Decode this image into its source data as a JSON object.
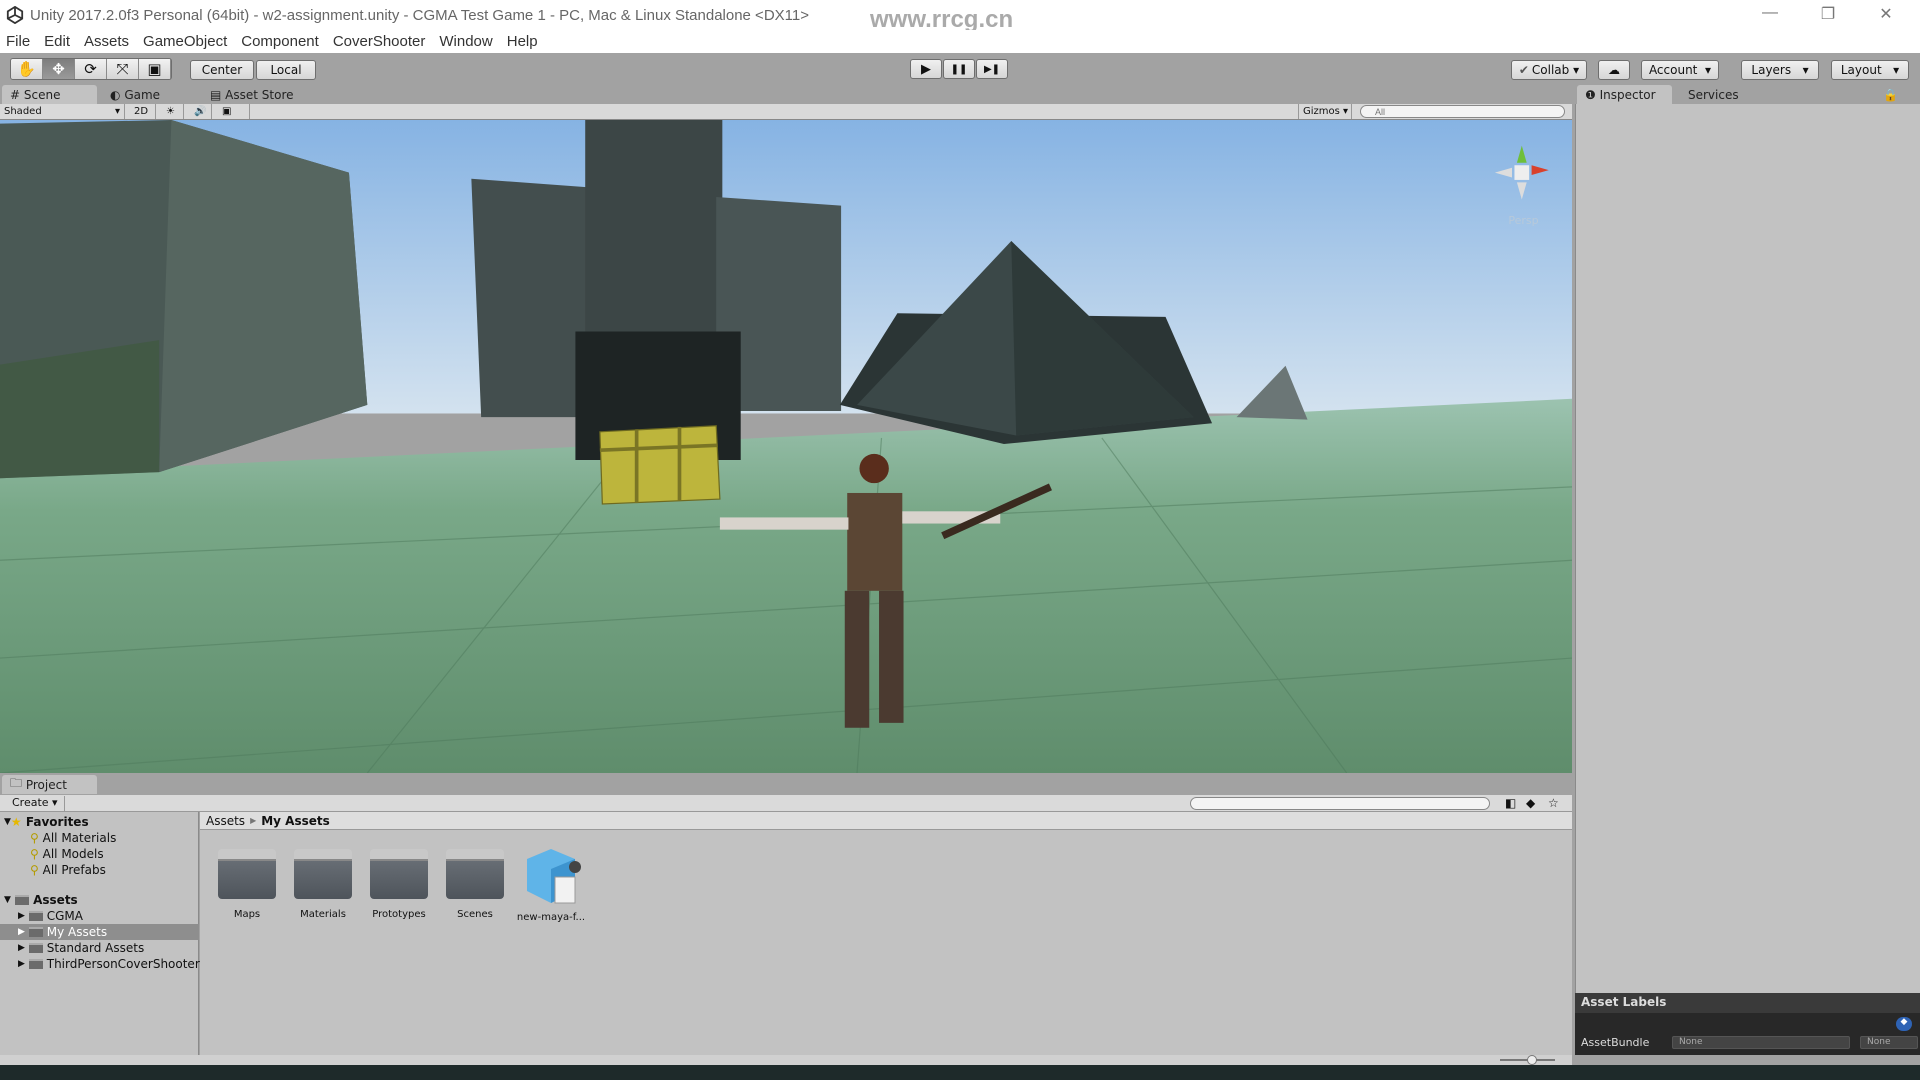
{
  "window": {
    "title": "Unity 2017.2.0f3 Personal (64bit) - w2-assignment.unity - CGMA Test Game 1 - PC, Mac & Linux Standalone <DX11>",
    "watermark": "www.rrcg.cn",
    "controls": [
      "—",
      "❐",
      "✕"
    ]
  },
  "menu": [
    "File",
    "Edit",
    "Assets",
    "GameObject",
    "Component",
    "CoverShooter",
    "Window",
    "Help"
  ],
  "toolbar": {
    "tools": [
      {
        "name": "hand",
        "glyph": "✋"
      },
      {
        "name": "move",
        "glyph": "✥"
      },
      {
        "name": "rotate",
        "glyph": "⟳"
      },
      {
        "name": "scale",
        "glyph": "⤧"
      },
      {
        "name": "rect",
        "glyph": "▣"
      }
    ],
    "active_tool": "move",
    "pivot": "Center",
    "space": "Local",
    "play": "▶",
    "pause": "❚❚",
    "step": "▶❚",
    "collab": "Collab",
    "cloud": "☁",
    "account": "Account",
    "layers": "Layers",
    "layout": "Layout"
  },
  "scene_tabs": [
    {
      "label": "Scene",
      "icon": "#"
    },
    {
      "label": "Game",
      "icon": "◐"
    },
    {
      "label": "Asset Store",
      "icon": "▤"
    }
  ],
  "scene_toolbar": {
    "shading": "Shaded",
    "mode_2d": "2D",
    "lighting": "☀",
    "audio": "🔊",
    "effects": "▣",
    "gizmos": "Gizmos",
    "search_placeholder": "All"
  },
  "scene": {
    "gizmo_label": "Persp",
    "colors": {
      "sky_top": "#86b3e3",
      "sky_horizon": "#cfe0ee",
      "ground": "#6b9a78",
      "chest": "#bdb53c"
    }
  },
  "inspector_tabs": [
    {
      "label": "Inspector",
      "icon": "❶"
    },
    {
      "label": "Services"
    }
  ],
  "asset_labels": {
    "title": "Asset Labels",
    "bundle_label": "AssetBundle",
    "bundle_value": "None",
    "variant_value": "None"
  },
  "project": {
    "tab": "Project",
    "create": "Create",
    "favorites": {
      "label": "Favorites",
      "items": [
        "All Materials",
        "All Models",
        "All Prefabs"
      ]
    },
    "assets": {
      "label": "Assets",
      "items": [
        "CGMA",
        "My Assets",
        "Standard Assets",
        "ThirdPersonCoverShooter"
      ],
      "selected": "My Assets"
    },
    "breadcrumb": [
      "Assets",
      "My Assets"
    ],
    "items": [
      {
        "name": "Maps",
        "type": "folder"
      },
      {
        "name": "Materials",
        "type": "folder"
      },
      {
        "name": "Prototypes",
        "type": "folder"
      },
      {
        "name": "Scenes",
        "type": "folder"
      },
      {
        "name": "new-maya-f...",
        "type": "model"
      }
    ]
  }
}
